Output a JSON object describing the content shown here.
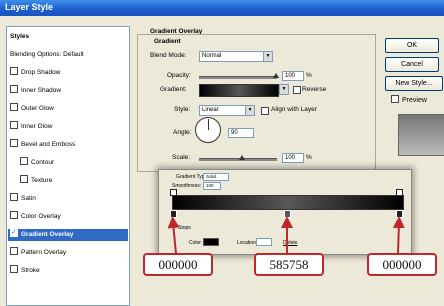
{
  "window": {
    "title": "Layer Style"
  },
  "sidebar": {
    "header": "Styles",
    "items": [
      {
        "label": "Blending Options: Default",
        "checkbox": false
      },
      {
        "label": "Drop Shadow",
        "checkbox": true
      },
      {
        "label": "Inner Shadow",
        "checkbox": true
      },
      {
        "label": "Outer Glow",
        "checkbox": true
      },
      {
        "label": "Inner Glow",
        "checkbox": true
      },
      {
        "label": "Bevel and Emboss",
        "checkbox": true
      },
      {
        "label": "Contour",
        "checkbox": true
      },
      {
        "label": "Texture",
        "checkbox": true
      },
      {
        "label": "Satin",
        "checkbox": true
      },
      {
        "label": "Color Overlay",
        "checkbox": true
      },
      {
        "label": "Gradient Overlay",
        "checkbox": true,
        "selected": true
      },
      {
        "label": "Pattern Overlay",
        "checkbox": true
      },
      {
        "label": "Stroke",
        "checkbox": true
      }
    ]
  },
  "panel": {
    "title": "Gradient Overlay",
    "subtitle": "Gradient",
    "blend_mode_label": "Blend Mode:",
    "blend_mode_value": "Normal",
    "opacity_label": "Opacity:",
    "opacity_value": "100",
    "gradient_label": "Gradient:",
    "reverse_label": "Reverse",
    "style_label": "Style:",
    "style_value": "Linear",
    "align_label": "Align with Layer",
    "angle_label": "Angle:",
    "angle_value": "90",
    "scale_label": "Scale:",
    "scale_value": "100",
    "percent": "%"
  },
  "buttons": {
    "ok": "OK",
    "cancel": "Cancel",
    "new_style": "New Style...",
    "preview": "Preview"
  },
  "editor": {
    "gradient_type_label": "Gradient Type:",
    "gradient_type_value": "Solid",
    "smoothness_label": "Smoothness:",
    "smoothness_value": "100",
    "stops_label": "Stops",
    "color_label": "Color:",
    "location_label": "Location:",
    "delete_label": "Delete"
  },
  "callouts": [
    "000000",
    "585758",
    "000000"
  ],
  "colors": {
    "stop_left": "#000000",
    "stop_mid": "#585758",
    "stop_right": "#000000",
    "callout_border": "#c0262d"
  }
}
